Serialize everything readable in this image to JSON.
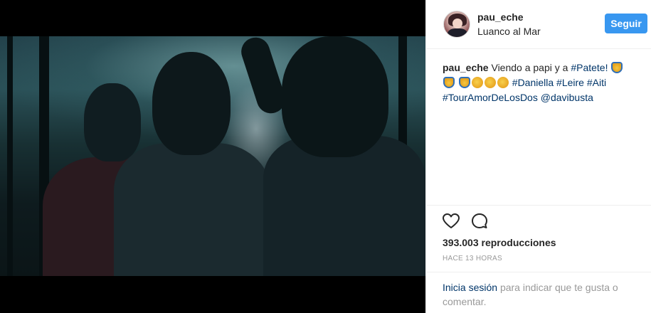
{
  "post": {
    "username": "pau_eche",
    "location": "Luanco al Mar",
    "follow_label": "Seguir",
    "caption": {
      "username": "pau_eche",
      "text_1": "Viendo a papi y a",
      "mention_1": "#Patete!",
      "hashtag_daniella": "#Daniella",
      "hashtag_leire": "#Leire",
      "hashtag_aiti": "#Aiti",
      "hashtag_tour": "#TourAmorDeLosDos",
      "mention_2": "@davibusta"
    },
    "views": "393.003 reproducciones",
    "time": "HACE 13 HORAS",
    "login": {
      "link": "Inicia sesión",
      "text": "para indicar que te gusta o comentar."
    }
  },
  "icons": {
    "heart": "heart-icon",
    "comment": "comment-icon",
    "emoji_raise": "raising-hands-emoji",
    "emoji_clap": "clapping-hands-emoji"
  },
  "colors": {
    "accent": "#3897f0",
    "link": "#003569",
    "muted": "#999999"
  }
}
